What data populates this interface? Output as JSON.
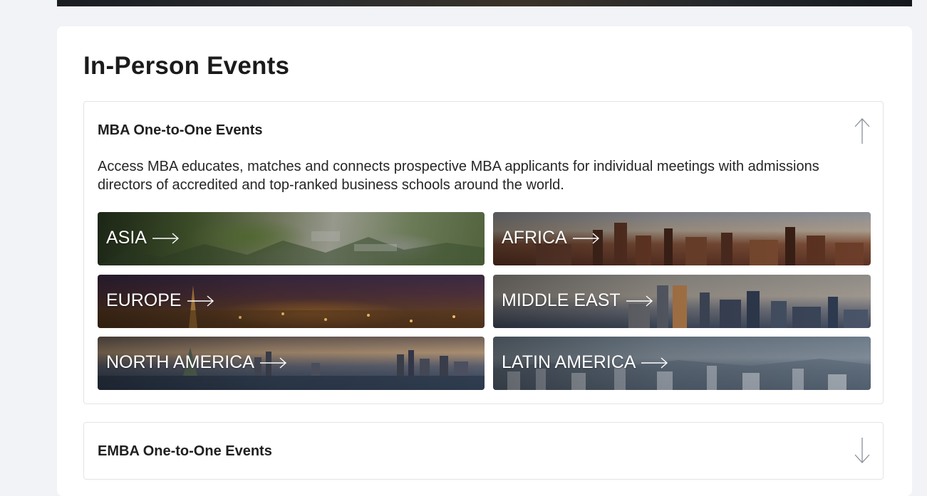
{
  "page": {
    "title": "In-Person Events"
  },
  "sections": [
    {
      "title": "MBA One-to-One Events",
      "expanded": true,
      "toggle_icon": "arrow-up-icon",
      "description": "Access MBA educates, matches and connects prospective MBA applicants for individual meetings with admissions directors of accredited and top-ranked business schools around the world.",
      "regions": [
        {
          "label": "ASIA",
          "icon": "arrow-right-icon"
        },
        {
          "label": "AFRICA",
          "icon": "arrow-right-icon"
        },
        {
          "label": "EUROPE",
          "icon": "arrow-right-icon"
        },
        {
          "label": "MIDDLE EAST",
          "icon": "arrow-right-icon"
        },
        {
          "label": "NORTH AMERICA",
          "icon": "arrow-right-icon"
        },
        {
          "label": "LATIN AMERICA",
          "icon": "arrow-right-icon"
        }
      ]
    },
    {
      "title": "EMBA One-to-One Events",
      "expanded": false,
      "toggle_icon": "arrow-down-icon"
    }
  ],
  "colors": {
    "page_bg": "#f2f3f6",
    "card_bg": "#ffffff",
    "border": "#e3e4e8",
    "text": "#1b1b1b",
    "icon_stroke": "#8a8f99"
  }
}
